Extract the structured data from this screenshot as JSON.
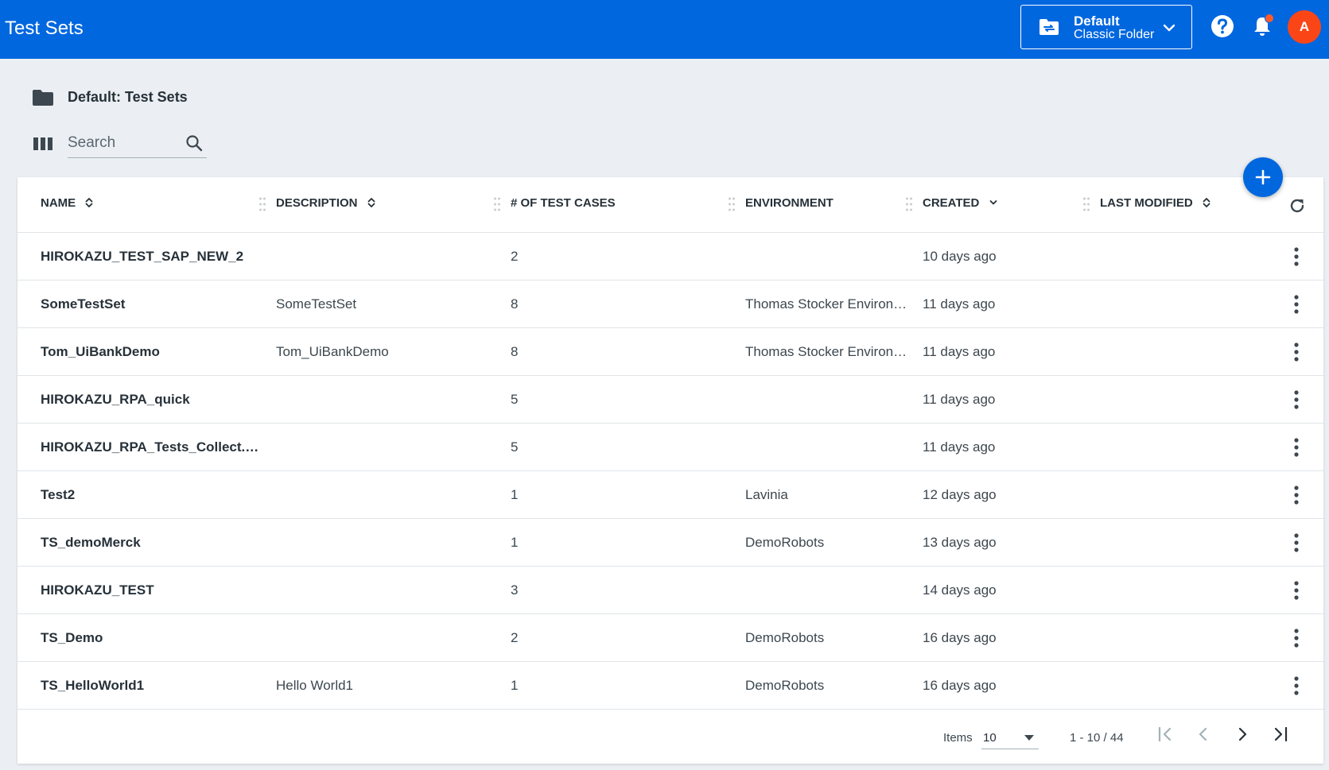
{
  "header": {
    "title": "Test Sets",
    "folder_line1": "Default",
    "folder_line2": "Classic Folder",
    "avatar_initial": "A",
    "accent": "#0067df",
    "avatar_color": "#fa4616"
  },
  "breadcrumb": {
    "text": "Default: Test Sets",
    "icon": "folder-icon"
  },
  "search": {
    "placeholder": "Search",
    "value": ""
  },
  "table": {
    "columns": {
      "name": "NAME",
      "description": "DESCRIPTION",
      "test_cases": "# OF TEST CASES",
      "environment": "ENVIRONMENT",
      "created": "CREATED",
      "last_modified": "LAST MODIFIED"
    },
    "rows": [
      {
        "name": "HIROKAZU_TEST_SAP_NEW_2",
        "description": "",
        "test_cases": "2",
        "environment": "",
        "created": "10 days ago"
      },
      {
        "name": "SomeTestSet",
        "description": "SomeTestSet",
        "test_cases": "8",
        "environment": "Thomas Stocker Environm...",
        "created": "11 days ago"
      },
      {
        "name": "Tom_UiBankDemo",
        "description": "Tom_UiBankDemo",
        "test_cases": "8",
        "environment": "Thomas Stocker Environm...",
        "created": "11 days ago"
      },
      {
        "name": "HIROKAZU_RPA_quick",
        "description": "",
        "test_cases": "5",
        "environment": "",
        "created": "11 days ago"
      },
      {
        "name": "HIROKAZU_RPA_Tests_Collect.Over...",
        "description": "",
        "test_cases": "5",
        "environment": "",
        "created": "11 days ago"
      },
      {
        "name": "Test2",
        "description": "",
        "test_cases": "1",
        "environment": "Lavinia",
        "created": "12 days ago"
      },
      {
        "name": "TS_demoMerck",
        "description": "",
        "test_cases": "1",
        "environment": "DemoRobots",
        "created": "13 days ago"
      },
      {
        "name": "HIROKAZU_TEST",
        "description": "",
        "test_cases": "3",
        "environment": "",
        "created": "14 days ago"
      },
      {
        "name": "TS_Demo",
        "description": "",
        "test_cases": "2",
        "environment": "DemoRobots",
        "created": "16 days ago"
      },
      {
        "name": "TS_HelloWorld1",
        "description": "Hello World1",
        "test_cases": "1",
        "environment": "DemoRobots",
        "created": "16 days ago"
      }
    ]
  },
  "pager": {
    "items_label": "Items",
    "page_size": "10",
    "range": "1 - 10 / 44"
  }
}
